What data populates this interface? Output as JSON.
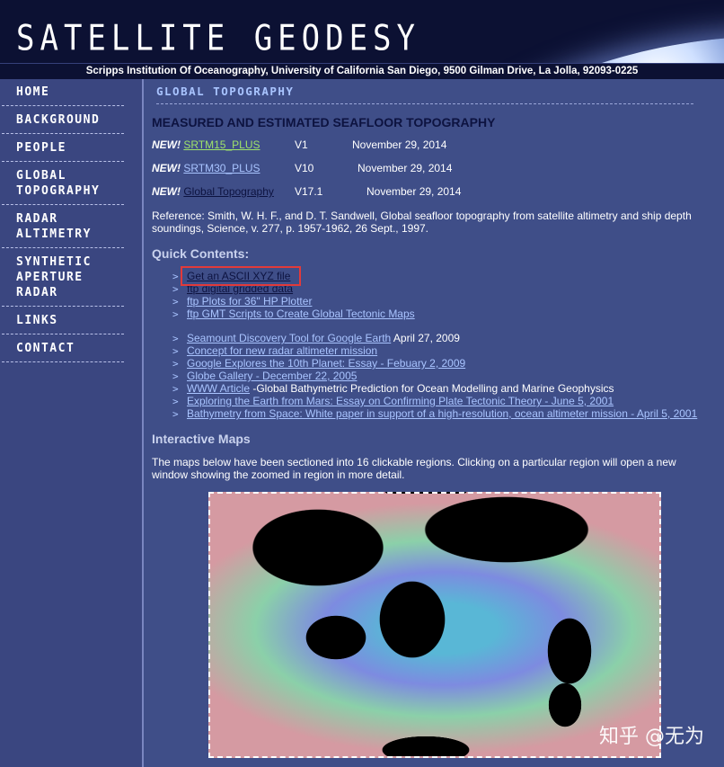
{
  "header": {
    "title": "SATELLITE GEODESY",
    "subtitle": "Scripps Institution Of Oceanography, University of California San Diego, 9500 Gilman Drive, La Jolla, 92093-0225"
  },
  "sidebar": {
    "items": [
      {
        "label": "HOME"
      },
      {
        "label": "BACKGROUND"
      },
      {
        "label": "PEOPLE"
      },
      {
        "label": "GLOBAL\nTOPOGRAPHY"
      },
      {
        "label": "RADAR\nALTIMETRY"
      },
      {
        "label": "SYNTHETIC\nAPERTURE\nRADAR"
      },
      {
        "label": "LINKS"
      },
      {
        "label": "CONTACT"
      }
    ]
  },
  "main": {
    "section_header": "GLOBAL TOPOGRAPHY",
    "page_title": "MEASURED AND ESTIMATED SEAFLOOR TOPOGRAPHY",
    "releases": [
      {
        "new": "NEW!",
        "name": "SRTM15_PLUS",
        "version": "V1",
        "date": "November 29, 2014",
        "color": "#9fe36a"
      },
      {
        "new": "NEW!",
        "name": "SRTM30_PLUS",
        "version": "V10",
        "date": "November 29, 2014",
        "color": "#a9c4ff"
      },
      {
        "new": "NEW!",
        "name": "Global Topography",
        "version": "V17.1",
        "date": "November 29, 2014",
        "color": "#0d1340"
      }
    ],
    "reference": "Reference:  Smith, W. H. F., and D. T. Sandwell, Global seafloor topography from satellite altimetry and ship depth soundings, Science, v. 277, p. 1957-1962, 26 Sept., 1997.",
    "quick_contents_heading": "Quick Contents:",
    "quick_links": [
      {
        "text": "Get an ASCII XYZ file",
        "extra": ""
      },
      {
        "text": "ftp digital gridded data",
        "extra": ""
      },
      {
        "text": "ftp Plots for 36\" HP Plotter",
        "extra": ""
      },
      {
        "text": "ftp GMT Scripts to Create Global Tectonic Maps",
        "extra": ""
      }
    ],
    "more_links": [
      {
        "text": "Seamount Discovery Tool for Google Earth",
        "extra": " April 27, 2009"
      },
      {
        "text": "Concept for new radar altimeter mission",
        "extra": ""
      },
      {
        "text": "Google Explores the 10th Planet: Essay - Febuary 2, 2009",
        "extra": ""
      },
      {
        "text": "Globe Gallery - December 22, 2005",
        "extra": ""
      },
      {
        "text": "WWW Article",
        "extra": " -Global Bathymetric Prediction for Ocean Modelling and Marine Geophysics"
      },
      {
        "text": "Exploring the Earth from Mars: Essay on Confirming Plate Tectonic Theory - June 5, 2001",
        "extra": ""
      },
      {
        "text": "Bathymetry from Space: White paper in support of a high-resolution, ocean altimeter mission - April 5, 2001",
        "extra": ""
      }
    ],
    "interactive_heading": "Interactive Maps",
    "interactive_text": "The maps below have been sectioned into 16 clickable regions. Clicking on a particular region will open a new window showing the zoomed in region in more detail."
  },
  "watermark": "知乎 @无为"
}
